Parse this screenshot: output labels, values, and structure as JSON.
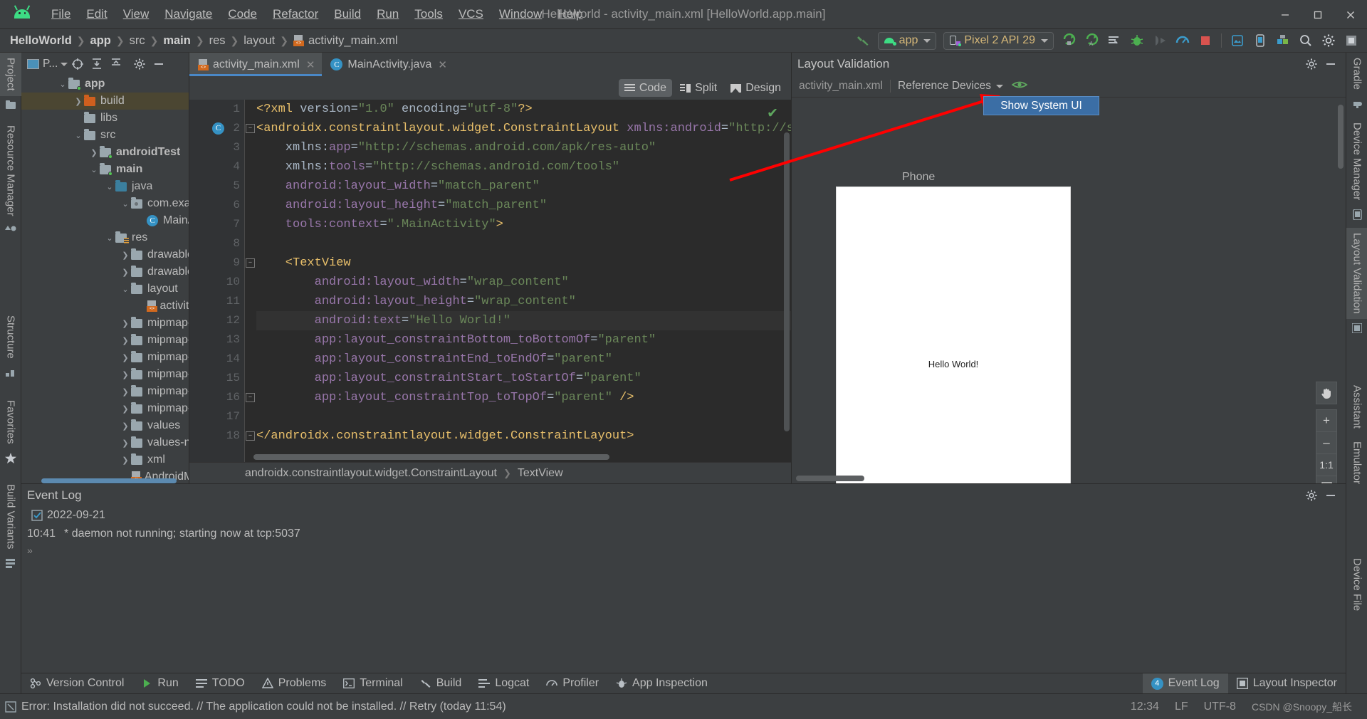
{
  "window": {
    "title": "HelloWorld - activity_main.xml [HelloWorld.app.main]",
    "minimize": "–",
    "maximize": "□",
    "close": "✕"
  },
  "menu": {
    "items": [
      "File",
      "Edit",
      "View",
      "Navigate",
      "Code",
      "Refactor",
      "Build",
      "Run",
      "Tools",
      "VCS",
      "Window",
      "Help"
    ]
  },
  "breadcrumbs": [
    {
      "label": "HelloWorld",
      "bold": true
    },
    {
      "label": "app",
      "bold": true
    },
    {
      "label": "src",
      "bold": false
    },
    {
      "label": "main",
      "bold": true
    },
    {
      "label": "res",
      "bold": false
    },
    {
      "label": "layout",
      "bold": false
    },
    {
      "label": "activity_main.xml",
      "bold": false,
      "icon": "xml-file-icon"
    }
  ],
  "toolbar": {
    "module_selector": "app",
    "device_selector": "Pixel 2 API 29",
    "icons": [
      "build-hammer-icon",
      "run-icon",
      "run-coverage-icon",
      "apply-changes-icon",
      "debug-icon",
      "profile-icon",
      "speed-icon",
      "stop-icon",
      "avd-manager-icon",
      "device-file-explorer-icon",
      "sdk-manager-icon",
      "search-icon",
      "settings-icon",
      "layout-inspector-icon"
    ]
  },
  "left_strip": {
    "top_tabs": [
      "Project"
    ],
    "tabs": [
      "Resource Manager",
      "Structure",
      "Favorites",
      "Build Variants"
    ]
  },
  "right_strip": {
    "tabs": [
      "Gradle",
      "Device Manager",
      "Layout Validation",
      "Assistant",
      "Emulator",
      "Device File"
    ]
  },
  "project_panel": {
    "title": "P...",
    "header_icons": [
      "select-opened-file-icon",
      "expand-all-icon",
      "collapse-all-icon",
      "settings-gear-icon",
      "hide-icon"
    ],
    "tree": [
      {
        "label": "app",
        "indent": 1,
        "arrow": "v",
        "icon": "module-folder",
        "bold": true,
        "selected": false
      },
      {
        "label": "build",
        "indent": 2,
        "arrow": ">",
        "icon": "folder-orange",
        "bold": false,
        "selected": true
      },
      {
        "label": "libs",
        "indent": 2,
        "arrow": "",
        "icon": "folder",
        "bold": false,
        "selected": false
      },
      {
        "label": "src",
        "indent": 2,
        "arrow": "v",
        "icon": "folder",
        "bold": false,
        "selected": false
      },
      {
        "label": "androidTest",
        "indent": 3,
        "arrow": ">",
        "icon": "source-folder",
        "bold": true,
        "selected": false
      },
      {
        "label": "main",
        "indent": 3,
        "arrow": "v",
        "icon": "source-folder",
        "bold": true,
        "selected": false
      },
      {
        "label": "java",
        "indent": 4,
        "arrow": "v",
        "icon": "folder-blue",
        "bold": false,
        "selected": false
      },
      {
        "label": "com.examp",
        "indent": 5,
        "arrow": "v",
        "icon": "package",
        "bold": false,
        "selected": false
      },
      {
        "label": "MainAc",
        "indent": 6,
        "arrow": "",
        "icon": "java-class",
        "bold": false,
        "selected": false
      },
      {
        "label": "res",
        "indent": 4,
        "arrow": "v",
        "icon": "res-folder",
        "bold": false,
        "selected": false
      },
      {
        "label": "drawable",
        "indent": 5,
        "arrow": ">",
        "icon": "folder",
        "bold": false,
        "selected": false
      },
      {
        "label": "drawable-v",
        "indent": 5,
        "arrow": ">",
        "icon": "folder",
        "bold": false,
        "selected": false
      },
      {
        "label": "layout",
        "indent": 5,
        "arrow": "v",
        "icon": "folder",
        "bold": false,
        "selected": false
      },
      {
        "label": "activity_",
        "indent": 6,
        "arrow": "",
        "icon": "xml-file",
        "bold": false,
        "selected": false
      },
      {
        "label": "mipmap-a",
        "indent": 5,
        "arrow": ">",
        "icon": "folder",
        "bold": false,
        "selected": false
      },
      {
        "label": "mipmap-h",
        "indent": 5,
        "arrow": ">",
        "icon": "folder",
        "bold": false,
        "selected": false
      },
      {
        "label": "mipmap-m",
        "indent": 5,
        "arrow": ">",
        "icon": "folder",
        "bold": false,
        "selected": false
      },
      {
        "label": "mipmap-xh",
        "indent": 5,
        "arrow": ">",
        "icon": "folder",
        "bold": false,
        "selected": false
      },
      {
        "label": "mipmap-xx",
        "indent": 5,
        "arrow": ">",
        "icon": "folder",
        "bold": false,
        "selected": false
      },
      {
        "label": "mipmap-xx",
        "indent": 5,
        "arrow": ">",
        "icon": "folder",
        "bold": false,
        "selected": false
      },
      {
        "label": "values",
        "indent": 5,
        "arrow": ">",
        "icon": "folder",
        "bold": false,
        "selected": false
      },
      {
        "label": "values-nigh",
        "indent": 5,
        "arrow": ">",
        "icon": "folder",
        "bold": false,
        "selected": false
      },
      {
        "label": "xml",
        "indent": 5,
        "arrow": ">",
        "icon": "folder",
        "bold": false,
        "selected": false
      },
      {
        "label": "AndroidMan",
        "indent": 5,
        "arrow": "",
        "icon": "xml-file",
        "bold": false,
        "selected": false
      }
    ]
  },
  "editor": {
    "tabs": [
      {
        "label": "activity_main.xml",
        "icon": "xml-file-icon",
        "active": true,
        "close": "✕"
      },
      {
        "label": "MainActivity.java",
        "icon": "java-class-icon",
        "active": false,
        "close": "✕"
      }
    ],
    "modes": [
      {
        "label": "Code",
        "active": true
      },
      {
        "label": "Split",
        "active": false
      },
      {
        "label": "Design",
        "active": false
      }
    ],
    "status_icon": "✔",
    "lines": [
      {
        "n": "1",
        "tokens": [
          {
            "t": "<?xml ",
            "c": "k-tag"
          },
          {
            "t": "version",
            "c": "k-plain"
          },
          {
            "t": "=",
            "c": "k-punc"
          },
          {
            "t": "\"1.0\"",
            "c": "k-str"
          },
          {
            "t": " encoding",
            "c": "k-plain"
          },
          {
            "t": "=",
            "c": "k-punc"
          },
          {
            "t": "\"utf-8\"",
            "c": "k-str"
          },
          {
            "t": "?>",
            "c": "k-tag"
          }
        ]
      },
      {
        "n": "2",
        "marker": "C",
        "fold": "–",
        "tokens": [
          {
            "t": "<androidx.constraintlayout.widget.ConstraintLayout ",
            "c": "k-tag"
          },
          {
            "t": "xmlns:android",
            "c": "k-ns"
          },
          {
            "t": "=",
            "c": "k-punc"
          },
          {
            "t": "\"http://schem",
            "c": "k-str"
          }
        ]
      },
      {
        "n": "3",
        "tokens": [
          {
            "t": "    xmlns:",
            "c": "k-plain"
          },
          {
            "t": "app",
            "c": "k-ns"
          },
          {
            "t": "=",
            "c": "k-punc"
          },
          {
            "t": "\"http://schemas.android.com/apk/res-auto\"",
            "c": "k-str"
          }
        ]
      },
      {
        "n": "4",
        "tokens": [
          {
            "t": "    xmlns:",
            "c": "k-plain"
          },
          {
            "t": "tools",
            "c": "k-ns"
          },
          {
            "t": "=",
            "c": "k-punc"
          },
          {
            "t": "\"http://schemas.android.com/tools\"",
            "c": "k-str"
          }
        ]
      },
      {
        "n": "5",
        "tokens": [
          {
            "t": "    android:layout_width",
            "c": "k-ns"
          },
          {
            "t": "=",
            "c": "k-punc"
          },
          {
            "t": "\"match_parent\"",
            "c": "k-str"
          }
        ]
      },
      {
        "n": "6",
        "tokens": [
          {
            "t": "    android:layout_height",
            "c": "k-ns"
          },
          {
            "t": "=",
            "c": "k-punc"
          },
          {
            "t": "\"match_parent\"",
            "c": "k-str"
          }
        ]
      },
      {
        "n": "7",
        "tokens": [
          {
            "t": "    tools:context",
            "c": "k-ns"
          },
          {
            "t": "=",
            "c": "k-punc"
          },
          {
            "t": "\".MainActivity\"",
            "c": "k-str"
          },
          {
            "t": ">",
            "c": "k-tag"
          }
        ]
      },
      {
        "n": "8",
        "tokens": []
      },
      {
        "n": "9",
        "fold": "–",
        "tokens": [
          {
            "t": "    <TextView",
            "c": "k-tag"
          }
        ]
      },
      {
        "n": "10",
        "tokens": [
          {
            "t": "        android:layout_width",
            "c": "k-ns"
          },
          {
            "t": "=",
            "c": "k-punc"
          },
          {
            "t": "\"wrap_content\"",
            "c": "k-str"
          }
        ]
      },
      {
        "n": "11",
        "tokens": [
          {
            "t": "        android:layout_height",
            "c": "k-ns"
          },
          {
            "t": "=",
            "c": "k-punc"
          },
          {
            "t": "\"wrap_content\"",
            "c": "k-str"
          }
        ]
      },
      {
        "n": "12",
        "hl": true,
        "tokens": [
          {
            "t": "        android:text",
            "c": "k-ns"
          },
          {
            "t": "=",
            "c": "k-punc"
          },
          {
            "t": "\"Hello World!\"",
            "c": "k-str"
          }
        ]
      },
      {
        "n": "13",
        "tokens": [
          {
            "t": "        app:layout_constraintBottom_toBottomOf",
            "c": "k-ns"
          },
          {
            "t": "=",
            "c": "k-punc"
          },
          {
            "t": "\"parent\"",
            "c": "k-str"
          }
        ]
      },
      {
        "n": "14",
        "tokens": [
          {
            "t": "        app:layout_constraintEnd_toEndOf",
            "c": "k-ns"
          },
          {
            "t": "=",
            "c": "k-punc"
          },
          {
            "t": "\"parent\"",
            "c": "k-str"
          }
        ]
      },
      {
        "n": "15",
        "tokens": [
          {
            "t": "        app:layout_constraintStart_toStartOf",
            "c": "k-ns"
          },
          {
            "t": "=",
            "c": "k-punc"
          },
          {
            "t": "\"parent\"",
            "c": "k-str"
          }
        ]
      },
      {
        "n": "16",
        "fold": "–",
        "tokens": [
          {
            "t": "        app:layout_constraintTop_toTopOf",
            "c": "k-ns"
          },
          {
            "t": "=",
            "c": "k-punc"
          },
          {
            "t": "\"parent\" ",
            "c": "k-str"
          },
          {
            "t": "/>",
            "c": "k-tag"
          }
        ]
      },
      {
        "n": "17",
        "tokens": []
      },
      {
        "n": "18",
        "fold": "–",
        "tokens": [
          {
            "t": "</androidx.constraintlayout.widget.ConstraintLayout>",
            "c": "k-tag"
          }
        ]
      }
    ],
    "breadcrumb": [
      "androidx.constraintlayout.widget.ConstraintLayout",
      "TextView"
    ]
  },
  "layout_validation": {
    "title": "Layout Validation",
    "file": "activity_main.xml",
    "reference_devices": "Reference Devices",
    "chevron": "▾",
    "eye_icon": "visibility-icon",
    "phone_label": "Phone",
    "preview_text": "Hello World!",
    "tooltip": "Show System UI",
    "zoom_controls": [
      "pan-tool-icon",
      "+",
      "–",
      "1:1",
      "fit-icon"
    ],
    "header_icons": [
      "settings-gear-icon",
      "hide-icon"
    ]
  },
  "event_log": {
    "title": "Event Log",
    "entries": [
      {
        "time": "",
        "icon": "log-entry-icon",
        "text": "2022-09-21"
      },
      {
        "time": "10:41",
        "text": "* daemon not running; starting now at tcp:5037"
      }
    ],
    "expand": "»",
    "header_icons": [
      "settings-gear-icon",
      "hide-icon"
    ]
  },
  "bottom_tabs": {
    "left": [
      {
        "label": "Version Control",
        "icon": "version-control-icon"
      },
      {
        "label": "Run",
        "icon": "run-icon"
      },
      {
        "label": "TODO",
        "icon": "todo-icon"
      },
      {
        "label": "Problems",
        "icon": "problems-icon"
      },
      {
        "label": "Terminal",
        "icon": "terminal-icon"
      },
      {
        "label": "Build",
        "icon": "build-hammer-icon"
      },
      {
        "label": "Logcat",
        "icon": "logcat-icon"
      },
      {
        "label": "Profiler",
        "icon": "profiler-icon"
      },
      {
        "label": "App Inspection",
        "icon": "app-inspection-icon"
      }
    ],
    "right": [
      {
        "label": "Event Log",
        "icon": "event-log-icon",
        "badge": "4",
        "active": true
      },
      {
        "label": "Layout Inspector",
        "icon": "layout-inspector-icon",
        "badge": "",
        "active": false
      }
    ]
  },
  "status_bar": {
    "icon": "error-icon",
    "message": "Error: Installation did not succeed. // The application could not be installed. // Retry (today 11:54)",
    "time": "12:34",
    "line_ending": "LF",
    "encoding": "UTF-8",
    "watermark": "CSDN @Snoopy_船长"
  }
}
